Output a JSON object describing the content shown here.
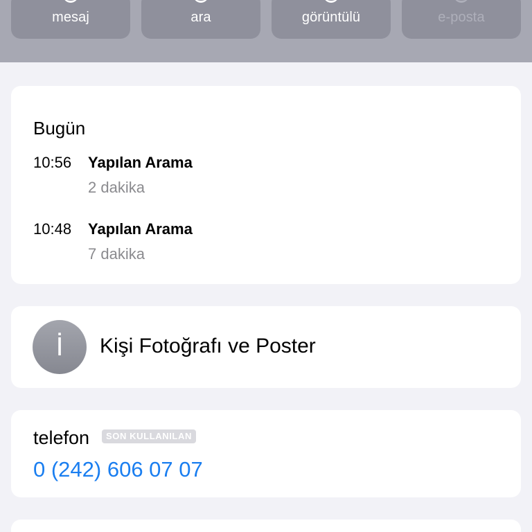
{
  "actions": {
    "message": "mesaj",
    "call": "ara",
    "video": "görüntülü",
    "email": "e-posta"
  },
  "history": {
    "title": "Bugün",
    "calls": [
      {
        "time": "10:56",
        "type": "Yapılan Arama",
        "duration": "2 dakika"
      },
      {
        "time": "10:48",
        "type": "Yapılan Arama",
        "duration": "7 dakika"
      }
    ]
  },
  "poster": {
    "avatar_glyph": "İ",
    "label": "Kişi Fotoğrafı ve Poster"
  },
  "phone": {
    "label": "telefon",
    "badge": "SON KULLANILAN",
    "number": "0 (242) 606 07 07"
  },
  "colors": {
    "header_background": "#a7a8b3",
    "button_background": "#8f909c",
    "page_background": "#f2f2f7",
    "link_blue": "#1a7ef0",
    "secondary_text": "#8a8a8e"
  }
}
